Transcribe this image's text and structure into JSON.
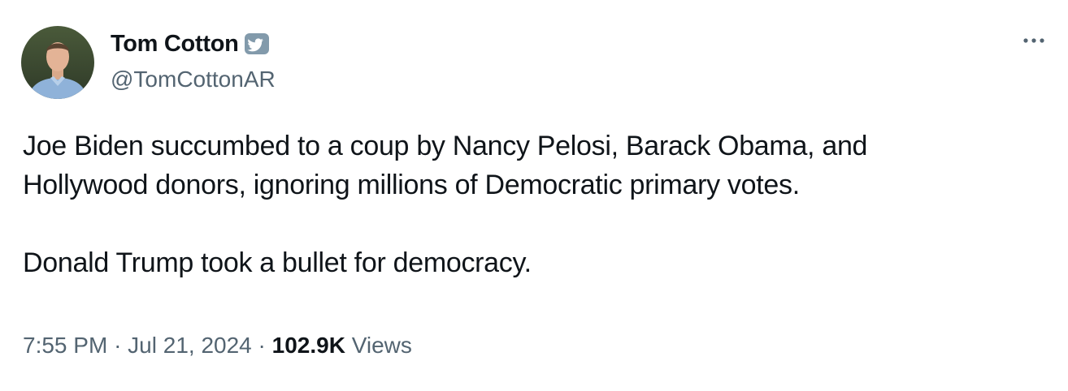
{
  "author": {
    "display_name": "Tom Cotton",
    "handle": "@TomCottonAR",
    "verified_badge_icon": "government-badge-icon"
  },
  "tweet": {
    "paragraph_1": "Joe Biden succumbed to a coup by Nancy Pelosi, Barack Obama, and\nHollywood donors, ignoring millions of Democratic primary votes.",
    "paragraph_2": "Donald Trump took a bullet for democracy."
  },
  "meta": {
    "time": "7:55 PM",
    "separator_1": "·",
    "date": "Jul 21, 2024",
    "separator_2": "·",
    "views_count": "102.9K",
    "views_label": "Views"
  },
  "icons": {
    "more": "more-options-icon",
    "avatar": "avatar"
  },
  "colors": {
    "text_primary": "#0f1419",
    "text_secondary": "#536471",
    "badge_gray": "#829aab"
  }
}
